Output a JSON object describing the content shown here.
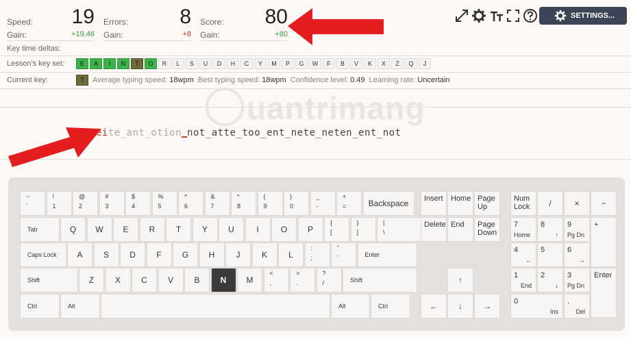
{
  "stats": {
    "speed": {
      "label": "Speed:",
      "value": "19",
      "gain_label": "Gain:",
      "gain": "+19.46"
    },
    "errors": {
      "label": "Errors:",
      "value": "8",
      "gain_label": "Gain:",
      "gain": "+8"
    },
    "score": {
      "label": "Score:",
      "value": "80",
      "gain_label": "Gain:",
      "gain": "+80"
    }
  },
  "toolbar": {
    "settings_label": "SETTINGS..."
  },
  "labels": {
    "key_time_deltas": "Key time deltas:",
    "lesson_key_set": "Lesson's key set:",
    "current_key": "Current key:"
  },
  "lesson_keys": [
    {
      "k": "E",
      "state": "learned"
    },
    {
      "k": "A",
      "state": "learned"
    },
    {
      "k": "I",
      "state": "learned"
    },
    {
      "k": "N",
      "state": "learned"
    },
    {
      "k": "T",
      "state": "current"
    },
    {
      "k": "O",
      "state": "learned"
    },
    {
      "k": "R",
      "state": "none"
    },
    {
      "k": "L",
      "state": "none"
    },
    {
      "k": "S",
      "state": "none"
    },
    {
      "k": "U",
      "state": "none"
    },
    {
      "k": "D",
      "state": "none"
    },
    {
      "k": "H",
      "state": "none"
    },
    {
      "k": "C",
      "state": "none"
    },
    {
      "k": "Y",
      "state": "none"
    },
    {
      "k": "M",
      "state": "none"
    },
    {
      "k": "P",
      "state": "none"
    },
    {
      "k": "G",
      "state": "none"
    },
    {
      "k": "W",
      "state": "none"
    },
    {
      "k": "F",
      "state": "none"
    },
    {
      "k": "B",
      "state": "none"
    },
    {
      "k": "V",
      "state": "none"
    },
    {
      "k": "K",
      "state": "none"
    },
    {
      "k": "X",
      "state": "none"
    },
    {
      "k": "Z",
      "state": "none"
    },
    {
      "k": "Q",
      "state": "none"
    },
    {
      "k": "J",
      "state": "none"
    }
  ],
  "current": {
    "key": "T",
    "avg_label": "Average typing speed:",
    "avg": "18wpm",
    "best_label": "Best typing speed:",
    "best": "18wpm",
    "conf_label": "Confidence level:",
    "conf": "0.49",
    "rate_label": "Learning rate:",
    "rate": "Uncertain"
  },
  "lesson": {
    "typed": "ei",
    "dimmed": "te_ant_otion",
    "rest": "not_atte_too_ent_nete_neten_ent_not"
  },
  "watermark": "uantrimang",
  "colors": {
    "learned": "#3cb34a",
    "current": "#6e6a3c",
    "arrow": "#e41e1e",
    "settings_bg": "#3b4555"
  },
  "keyboard": {
    "row1": [
      [
        "~",
        "`"
      ],
      [
        "!",
        "1"
      ],
      [
        "@",
        "2"
      ],
      [
        "#",
        "3"
      ],
      [
        "$",
        "4"
      ],
      [
        "%",
        "5"
      ],
      [
        "^",
        "6"
      ],
      [
        "&",
        "7"
      ],
      [
        "*",
        "8"
      ],
      [
        "(",
        "9"
      ],
      [
        ")",
        "0"
      ],
      [
        "_",
        "-"
      ],
      [
        "+",
        "="
      ]
    ],
    "backspace": "Backspace",
    "tab": "Tab",
    "row2": [
      "Q",
      "W",
      "E",
      "R",
      "T",
      "Y",
      "U",
      "I",
      "O",
      "P"
    ],
    "row2_sym": [
      [
        "{",
        "["
      ],
      [
        "}",
        "]"
      ],
      [
        "|",
        "\\"
      ]
    ],
    "caps": "Caps Lock",
    "row3": [
      "A",
      "S",
      "D",
      "F",
      "G",
      "H",
      "J",
      "K",
      "L"
    ],
    "row3_sym": [
      [
        ":",
        ";"
      ],
      [
        "\"",
        "'"
      ]
    ],
    "enter": "Enter",
    "shift_l": "Shift",
    "row4": [
      "Z",
      "X",
      "C",
      "V",
      "B",
      "N",
      "M"
    ],
    "row4_sym": [
      [
        "<",
        ","
      ],
      [
        ">",
        "."
      ],
      [
        "?",
        "/"
      ]
    ],
    "shift_r": "Shift",
    "ctrl_l": "Ctrl",
    "alt_l": "Alt",
    "alt_r": "Alt",
    "ctrl_r": "Ctrl",
    "nav": {
      "insert": "Insert",
      "home": "Home",
      "page_up": "Page Up",
      "delete": "Delete",
      "end": "End",
      "page_down": "Page Down"
    },
    "arrows": {
      "up": "↑",
      "left": "←",
      "down": "↓",
      "right": "→"
    },
    "numpad": {
      "numlock": "Num Lock",
      "div": "/",
      "mul": "×",
      "minus": "−",
      "plus": "+",
      "enter": "Enter",
      "n7": "7",
      "n7s": "Home",
      "n8": "8",
      "n8s": "↑",
      "n9": "9",
      "n9s": "Pg Dn",
      "n4": "4",
      "n4s": "←",
      "n5": "5",
      "n6": "6",
      "n6s": "→",
      "n1": "1",
      "n1s": "End",
      "n2": "2",
      "n2s": "↓",
      "n3": "3",
      "n3s": "Pg Dn",
      "n0": "0",
      "n0s": "Ins",
      "dot": ".",
      "dots": "Del"
    },
    "highlight": "N"
  }
}
